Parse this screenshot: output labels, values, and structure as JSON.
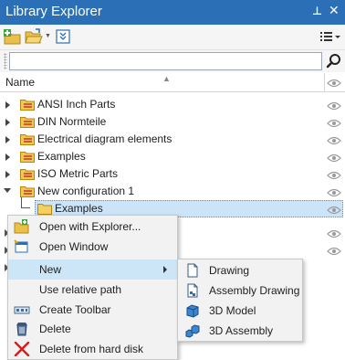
{
  "window": {
    "title": "Library Explorer",
    "pin_glyph": "⊥",
    "close_glyph": "✕"
  },
  "toolbar": {
    "buttons": [
      {
        "icon": "new-library-icon",
        "has_dropdown": false
      },
      {
        "icon": "open-folder-icon",
        "has_dropdown": true
      },
      {
        "icon": "collapse-all-icon",
        "has_dropdown": false
      }
    ],
    "view_options_icon": "list-view-icon"
  },
  "search": {
    "value": "",
    "placeholder": ""
  },
  "columns": {
    "name": "Name",
    "sort_glyph": "▲"
  },
  "tree": {
    "items": [
      {
        "label": "ANSI Inch Parts",
        "expanded": false
      },
      {
        "label": "DIN Normteile",
        "expanded": false
      },
      {
        "label": "Electrical diagram elements",
        "expanded": false
      },
      {
        "label": "Examples",
        "expanded": false
      },
      {
        "label": "ISO Metric Parts",
        "expanded": false
      },
      {
        "label": "New configuration 1",
        "expanded": true
      },
      {
        "label": "Examples",
        "expanded": false,
        "selected": true,
        "child": true
      }
    ]
  },
  "context_menu": {
    "items": [
      {
        "label": "Open with Explorer...",
        "icon": "explorer-icon"
      },
      {
        "label": "Open Window",
        "icon": "window-icon"
      },
      {
        "label": "New",
        "icon": "",
        "submenu": true,
        "hovered": true
      },
      {
        "label": "Use relative path",
        "icon": ""
      },
      {
        "label": "Create Toolbar",
        "icon": "toolbar-icon"
      },
      {
        "label": "Delete",
        "icon": "delete-icon"
      },
      {
        "label": "Delete from hard disk",
        "icon": "delete-disk-icon"
      }
    ]
  },
  "submenu": {
    "items": [
      {
        "label": "Drawing",
        "icon": "drawing-icon"
      },
      {
        "label": "Assembly Drawing",
        "icon": "assembly-drawing-icon"
      },
      {
        "label": "3D Model",
        "icon": "3d-model-icon"
      },
      {
        "label": "3D Assembly",
        "icon": "3d-assembly-icon"
      }
    ]
  },
  "colors": {
    "titlebar": "#2b6fb6",
    "selection": "#cce4f7",
    "menu_hover": "#cde6f7",
    "menu_bg": "#f2f2f2"
  }
}
